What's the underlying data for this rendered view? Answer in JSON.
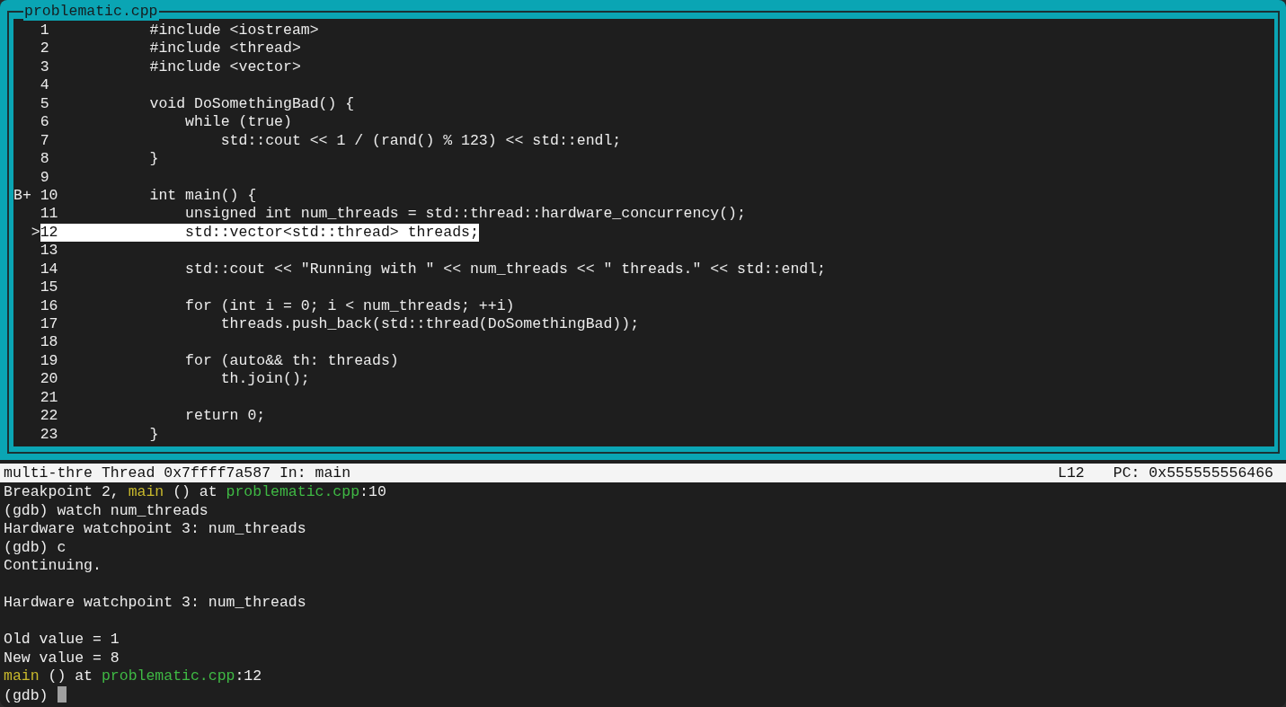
{
  "source_window": {
    "title": "problematic.cpp",
    "lines": [
      {
        "number": "1",
        "code": "#include <iostream>",
        "current": false
      },
      {
        "number": "2",
        "code": "#include <thread>",
        "current": false
      },
      {
        "number": "3",
        "code": "#include <vector>",
        "current": false
      },
      {
        "number": "4",
        "current": false
      },
      {
        "number": "5",
        "code": "void DoSomethingBad() {",
        "current": false
      },
      {
        "number": "6",
        "code": "    while (true)",
        "current": false
      },
      {
        "number": "7",
        "code": "        std::cout << 1 / (rand() % 123) << std::endl;",
        "current": false
      },
      {
        "number": "8",
        "code": "}",
        "current": false
      },
      {
        "number": "9",
        "current": false
      },
      {
        "number": "10",
        "marker": "B+",
        "code": "int main() {",
        "current": false
      },
      {
        "number": "11",
        "code": "    unsigned int num_threads = std::thread::hardware_concurrency();",
        "current": false
      },
      {
        "number": "12",
        "marker": ">",
        "code": "    std::vector<std::thread> threads;",
        "current": true
      },
      {
        "number": "13",
        "current": false
      },
      {
        "number": "14",
        "code": "    std::cout << \"Running with \" << num_threads << \" threads.\" << std::endl;",
        "current": false
      },
      {
        "number": "15",
        "current": false
      },
      {
        "number": "16",
        "code": "    for (int i = 0; i < num_threads; ++i)",
        "current": false
      },
      {
        "number": "17",
        "code": "        threads.push_back(std::thread(DoSomethingBad));",
        "current": false
      },
      {
        "number": "18",
        "current": false
      },
      {
        "number": "19",
        "code": "    for (auto&& th: threads)",
        "current": false
      },
      {
        "number": "20",
        "code": "        th.join();",
        "current": false
      },
      {
        "number": "21",
        "current": false
      },
      {
        "number": "22",
        "code": "    return 0;",
        "current": false
      },
      {
        "number": "23",
        "code": "}",
        "current": false
      }
    ]
  },
  "status_bar": {
    "thread_info": "multi-thre Thread 0x7ffff7a587 In: main",
    "line": "L12",
    "pc": "PC: 0x555555556466"
  },
  "console": [
    {
      "kind": "output",
      "segments": [
        {
          "kind": "text",
          "text": "Breakpoint 2, "
        },
        {
          "kind": "function",
          "text": "main"
        },
        {
          "kind": "text",
          "text": " () at "
        },
        {
          "kind": "file",
          "text": "problematic.cpp"
        },
        {
          "kind": "text",
          "text": ":10"
        }
      ]
    },
    {
      "kind": "output",
      "segments": [
        {
          "kind": "text",
          "text": "(gdb) watch num_threads"
        }
      ]
    },
    {
      "kind": "output",
      "segments": [
        {
          "kind": "text",
          "text": "Hardware watchpoint 3: num_threads"
        }
      ]
    },
    {
      "kind": "output",
      "segments": [
        {
          "kind": "text",
          "text": "(gdb) c"
        }
      ]
    },
    {
      "kind": "output",
      "segments": [
        {
          "kind": "text",
          "text": "Continuing."
        }
      ]
    },
    {
      "kind": "blank"
    },
    {
      "kind": "output",
      "segments": [
        {
          "kind": "text",
          "text": "Hardware watchpoint 3: num_threads"
        }
      ]
    },
    {
      "kind": "blank"
    },
    {
      "kind": "output",
      "segments": [
        {
          "kind": "text",
          "text": "Old value = 1"
        }
      ]
    },
    {
      "kind": "output",
      "segments": [
        {
          "kind": "text",
          "text": "New value = 8"
        }
      ]
    },
    {
      "kind": "output",
      "segments": [
        {
          "kind": "function",
          "text": "main"
        },
        {
          "kind": "text",
          "text": " () at "
        },
        {
          "kind": "file",
          "text": "problematic.cpp"
        },
        {
          "kind": "text",
          "text": ":12"
        }
      ]
    },
    {
      "kind": "prompt",
      "text": "(gdb)",
      "cursor": true
    }
  ]
}
